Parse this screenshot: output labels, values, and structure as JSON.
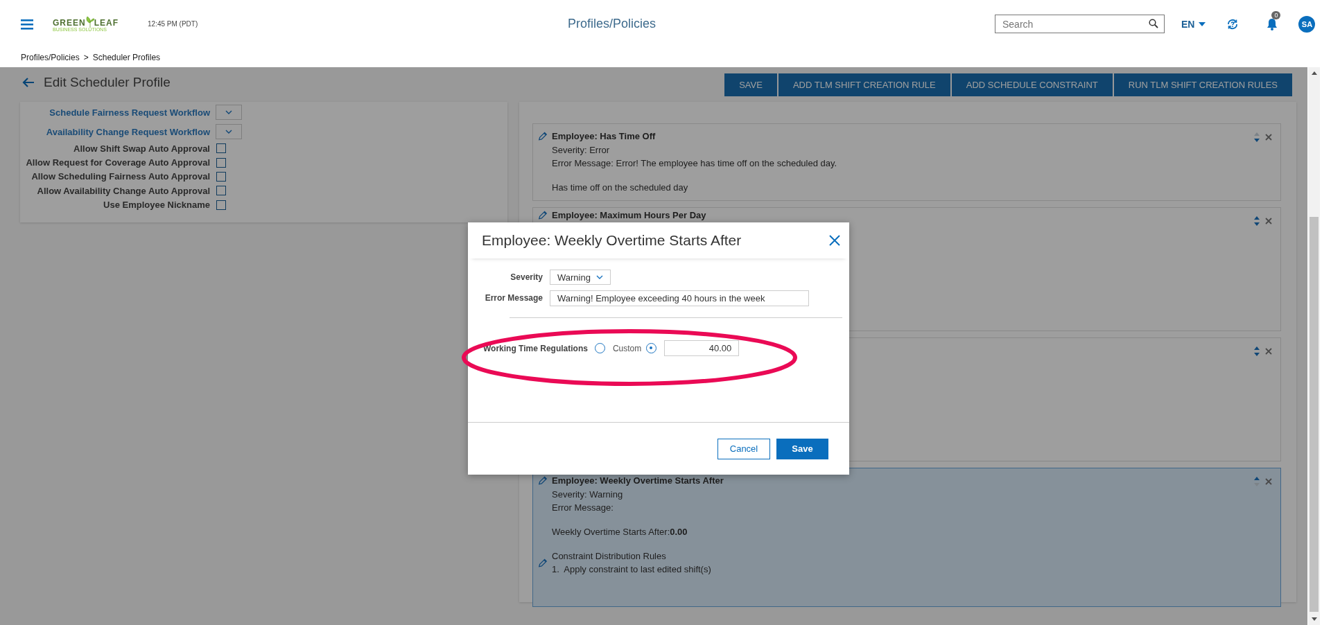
{
  "header": {
    "logo": {
      "name_start": "GREEN",
      "name_end": "LEAF",
      "tagline": "BUSINESS SOLUTIONS"
    },
    "time": "12:45 PM (PDT)",
    "title": "Profiles/Policies",
    "search": {
      "placeholder": "Search"
    },
    "language": "EN",
    "notifications": "0",
    "avatar": "SA"
  },
  "breadcrumb": {
    "items": [
      "Profiles/Policies",
      "Scheduler Profiles"
    ],
    "separator": ">"
  },
  "page": {
    "title": "Edit Scheduler Profile",
    "actions": [
      "SAVE",
      "ADD TLM SHIFT CREATION RULE",
      "ADD SCHEDULE CONSTRAINT",
      "RUN TLM SHIFT CREATION RULES"
    ]
  },
  "settings": [
    {
      "kind": "dropdown",
      "label": "Schedule Fairness Request Workflow"
    },
    {
      "kind": "dropdown",
      "label": "Availability Change Request Workflow"
    },
    {
      "kind": "checkbox",
      "label": "Allow Shift Swap Auto Approval",
      "checked": false
    },
    {
      "kind": "checkbox",
      "label": "Allow Request for Coverage Auto Approval",
      "checked": false
    },
    {
      "kind": "checkbox",
      "label": "Allow Scheduling Fairness Auto Approval",
      "checked": false
    },
    {
      "kind": "checkbox",
      "label": "Allow Availability Change Auto Approval",
      "checked": false
    },
    {
      "kind": "checkbox",
      "label": "Use Employee Nickname",
      "checked": false
    }
  ],
  "constraints": [
    {
      "title": "Employee: Has Time Off",
      "selected": false,
      "move_up_enabled": false,
      "move_down_enabled": true,
      "details": [
        [
          "Severity: Error",
          "Error Message: Error! The employee has time off on the scheduled day."
        ],
        [
          "Has time off on the scheduled day"
        ]
      ]
    },
    {
      "title": "Employee: Maximum Hours Per Day",
      "selected": false,
      "move_up_enabled": true,
      "move_down_enabled": true
    },
    {
      "selected": false,
      "move_up_enabled": true,
      "move_down_enabled": true
    },
    {
      "title": "Employee: Weekly Overtime Starts After",
      "selected": true,
      "move_up_enabled": true,
      "move_down_enabled": false,
      "details": [
        [
          "Severity: Warning",
          "Error Message:"
        ],
        [
          "Weekly Overtime Starts After:**0.00**"
        ]
      ],
      "distribution": {
        "title": "Constraint Distribution Rules",
        "rules": [
          "1.  Apply constraint to last edited shift(s)"
        ]
      }
    }
  ],
  "dialog": {
    "title": "Employee: Weekly Overtime Starts After",
    "fields": [
      {
        "kind": "select",
        "label": "Severity",
        "value": "Warning"
      },
      {
        "kind": "text",
        "label": "Error Message",
        "value": "Warning! Employee exceeding 40 hours in the week"
      }
    ],
    "regulation": {
      "highlighted": true,
      "options": [
        {
          "kind": "preset",
          "label": "Working Time Regulations",
          "selected": false
        },
        {
          "kind": "custom",
          "label": "Custom",
          "selected": true,
          "value": "40.00"
        }
      ]
    },
    "buttons": [
      {
        "kind": "secondary",
        "label": "Cancel"
      },
      {
        "kind": "primary",
        "label": "Save"
      }
    ]
  }
}
